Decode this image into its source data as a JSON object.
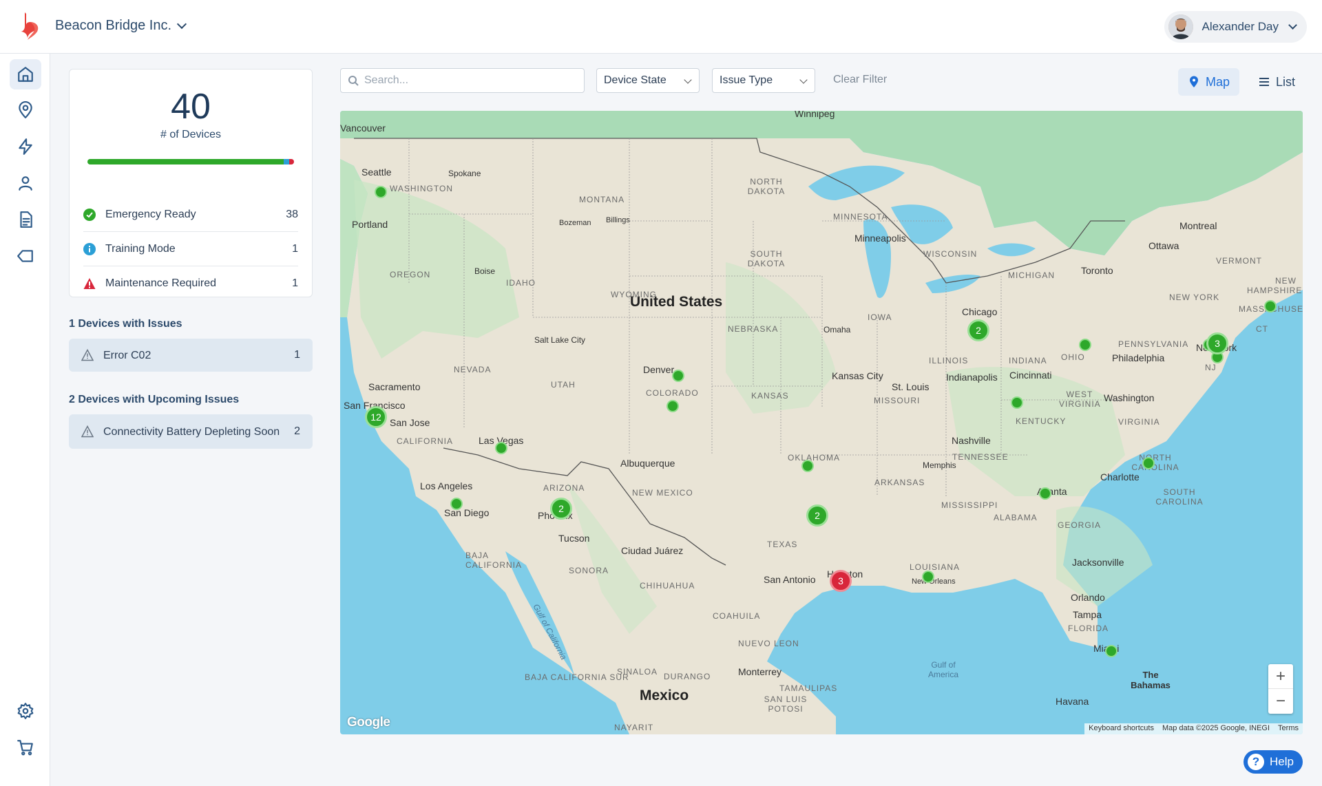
{
  "header": {
    "org_name": "Beacon Bridge Inc.",
    "user_name": "Alexander Day"
  },
  "sidebar": {
    "items": [
      {
        "icon": "home-icon"
      },
      {
        "icon": "location-pin-icon"
      },
      {
        "icon": "lightning-icon"
      },
      {
        "icon": "user-icon"
      },
      {
        "icon": "document-icon"
      },
      {
        "icon": "tag-icon"
      },
      {
        "icon": "gear-icon"
      },
      {
        "icon": "cart-icon"
      }
    ]
  },
  "summary": {
    "total": "40",
    "total_label": "# of Devices",
    "statuses": [
      {
        "label": "Emergency Ready",
        "count": "38",
        "color": "#2ea82a"
      },
      {
        "label": "Training Mode",
        "count": "1",
        "color": "#2b9fd6"
      },
      {
        "label": "Maintenance Required",
        "count": "1",
        "color": "#d8263b"
      }
    ]
  },
  "issues": {
    "title": "1 Devices with Issues",
    "items": [
      {
        "label": "Error C02",
        "count": "1"
      }
    ]
  },
  "upcoming": {
    "title": "2 Devices with Upcoming Issues",
    "items": [
      {
        "label": "Connectivity Battery Depleting Soon",
        "count": "2"
      }
    ]
  },
  "filters": {
    "search_placeholder": "Search...",
    "device_state": "Device State",
    "issue_type": "Issue Type",
    "clear": "Clear Filter"
  },
  "view_toggle": {
    "map": "Map",
    "list": "List",
    "active": "map"
  },
  "map": {
    "countries": [
      "United States",
      "Mexico"
    ],
    "cities": [
      "Winnipeg",
      "Vancouver",
      "Seattle",
      "Spokane",
      "Portland",
      "Boise",
      "Bozeman",
      "Billings",
      "Salt Lake City",
      "Denver",
      "Sacramento",
      "San Francisco",
      "San Jose",
      "Las Vegas",
      "Los Angeles",
      "San Diego",
      "Phoenix",
      "Tucson",
      "Albuquerque",
      "Ciudad Juárez",
      "Minneapolis",
      "Omaha",
      "Kansas City",
      "Chicago",
      "St. Louis",
      "Indianapolis",
      "Cincinnati",
      "Toronto",
      "Ottawa",
      "Montreal",
      "Philadelphia",
      "Washington",
      "New York",
      "Nashville",
      "Memphis",
      "Atlanta",
      "Charlotte",
      "Jacksonville",
      "Orlando",
      "Tampa",
      "Miami",
      "New Orleans",
      "San Antonio",
      "Houston",
      "Monterrey",
      "Havana",
      "The Bahamas"
    ],
    "regions": [
      "WASHINGTON",
      "MONTANA",
      "NORTH DAKOTA",
      "SOUTH DAKOTA",
      "MINNESOTA",
      "WISCONSIN",
      "MICHIGAN",
      "OREGON",
      "IDAHO",
      "WYOMING",
      "NEBRASKA",
      "IOWA",
      "NEVADA",
      "UTAH",
      "COLORADO",
      "KANSAS",
      "MISSOURI",
      "ILLINOIS",
      "INDIANA",
      "OHIO",
      "PENNSYLVANIA",
      "NEW YORK",
      "VERMONT",
      "NEW HAMPSHIRE",
      "MASSACHUSETTS",
      "CT",
      "NJ",
      "WEST VIRGINIA",
      "VIRGINIA",
      "KENTUCKY",
      "TENNESSEE",
      "NORTH CAROLINA",
      "SOUTH CAROLINA",
      "GEORGIA",
      "ALABAMA",
      "MISSISSIPPI",
      "ARKANSAS",
      "OKLAHOMA",
      "TEXAS",
      "LOUISIANA",
      "FLORIDA",
      "CALIFORNIA",
      "ARIZONA",
      "NEW MEXICO",
      "BAJA CALIFORNIA",
      "SONORA",
      "CHIHUAHUA",
      "COAHUILA",
      "NUEVO LEON",
      "TAMAULIPAS",
      "SINALOA",
      "DURANGO",
      "BAJA CALIFORNIA SUR",
      "SAN LUIS POTOSI",
      "NAYARIT",
      "Gulf of California",
      "Gulf of America"
    ],
    "clusters": [
      "12",
      "2",
      "2",
      "2",
      "3",
      "3"
    ],
    "google_mark": "Google",
    "attribution": [
      "Keyboard shortcuts",
      "Map data ©2025 Google, INEGI",
      "Terms"
    ]
  },
  "help_label": "Help"
}
